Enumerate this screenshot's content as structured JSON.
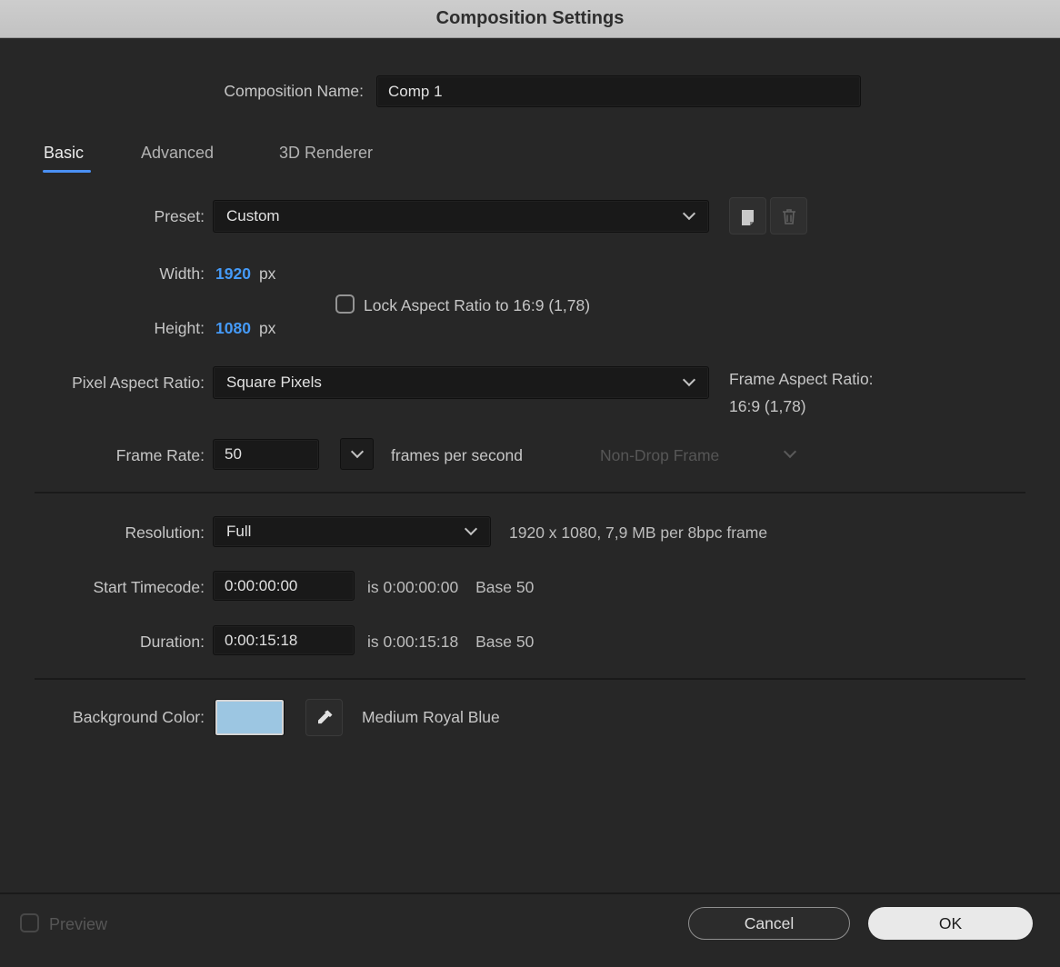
{
  "title": "Composition Settings",
  "name_row": {
    "label": "Composition Name:",
    "value": "Comp 1"
  },
  "tabs": {
    "basic": "Basic",
    "advanced": "Advanced",
    "renderer": "3D Renderer"
  },
  "preset": {
    "label": "Preset:",
    "value": "Custom"
  },
  "width": {
    "label": "Width:",
    "value": "1920",
    "unit": "px"
  },
  "height": {
    "label": "Height:",
    "value": "1080",
    "unit": "px"
  },
  "lock_aspect": {
    "label": "Lock Aspect Ratio to 16:9 (1,78)",
    "checked": false
  },
  "par": {
    "label": "Pixel Aspect Ratio:",
    "value": "Square Pixels"
  },
  "far": {
    "label": "Frame Aspect Ratio:",
    "value": "16:9 (1,78)"
  },
  "frame_rate": {
    "label": "Frame Rate:",
    "value": "50",
    "suffix": "frames per second",
    "dropframe": "Non-Drop Frame"
  },
  "resolution": {
    "label": "Resolution:",
    "value": "Full",
    "info": "1920 x 1080, 7,9 MB per 8bpc frame"
  },
  "start_timecode": {
    "label": "Start Timecode:",
    "value": "0:00:00:00",
    "is_text": "is 0:00:00:00",
    "base_text": "Base 50"
  },
  "duration": {
    "label": "Duration:",
    "value": "0:00:15:18",
    "is_text": "is 0:00:15:18",
    "base_text": "Base 50"
  },
  "bg_color": {
    "label": "Background Color:",
    "name": "Medium Royal Blue",
    "swatch": "#9cc6e2"
  },
  "footer": {
    "preview": "Preview",
    "cancel": "Cancel",
    "ok": "OK"
  },
  "colors": {
    "accent_blue": "#4a90f4",
    "value_blue": "#459af7"
  }
}
